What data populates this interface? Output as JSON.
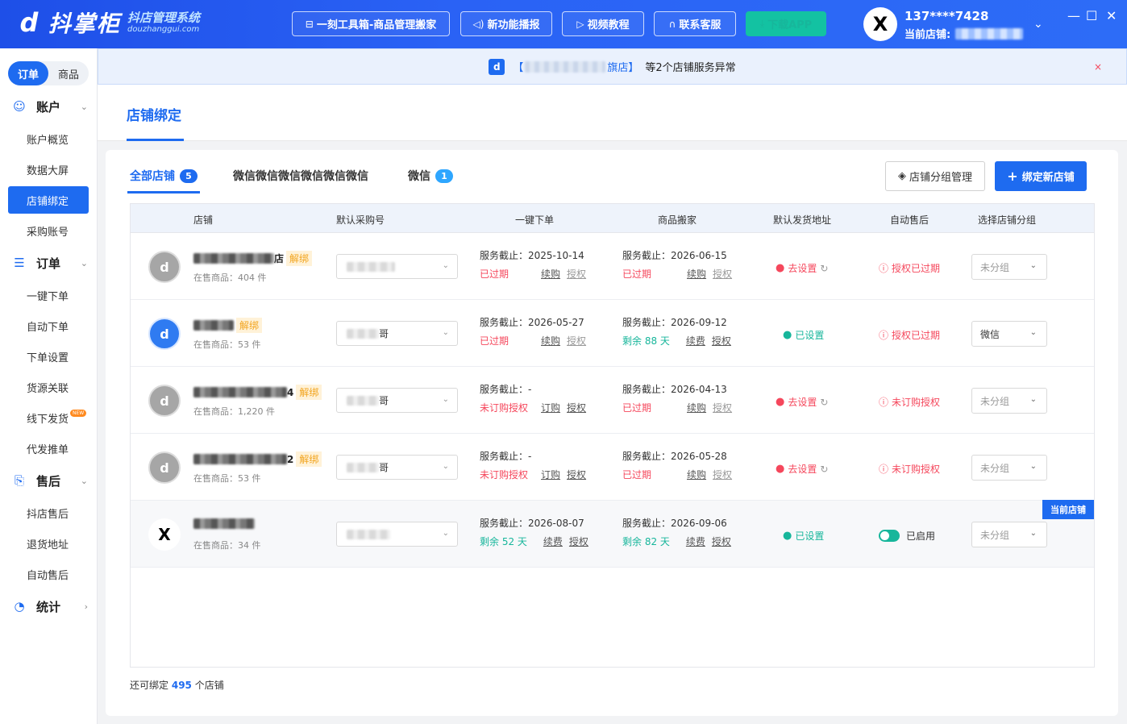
{
  "app": {
    "logo_mark": "d",
    "name": "抖掌柜",
    "subtitle": "抖店管理系统",
    "domain": "douzhanggui.com"
  },
  "toolbar": {
    "tools_label": "一刻工具箱-商品管理搬家",
    "news_label": "新功能播报",
    "video_label": "视频教程",
    "service_label": "联系客服",
    "download_label": "下载APP"
  },
  "user": {
    "avatar": "X",
    "phone": "137****7428",
    "store_label": "当前店铺:"
  },
  "window": {
    "minimize": "—",
    "maximize": "☐",
    "close": "✕"
  },
  "sidebar": {
    "seg": [
      "订单",
      "商品"
    ],
    "groups": {
      "account": {
        "label": "账户",
        "items": [
          "账户概览",
          "数据大屏",
          "店铺绑定",
          "采购账号"
        ]
      },
      "order": {
        "label": "订单",
        "items": [
          "一键下单",
          "自动下单",
          "下单设置",
          "货源关联",
          "线下发货",
          "代发推单"
        ]
      },
      "after": {
        "label": "售后",
        "items": [
          "抖店售后",
          "退货地址",
          "自动售后"
        ]
      },
      "stats": {
        "label": "统计"
      }
    },
    "new_tag": "NEW"
  },
  "notice": {
    "logo": "d",
    "prefix": "【",
    "store_suffix": "旗店】",
    "text": "等2个店铺服务异常",
    "close": "×"
  },
  "page": {
    "title": "店铺绑定"
  },
  "tabs": [
    {
      "label": "全部店铺",
      "count": "5"
    },
    {
      "label": "微信微信微信微信微信微信"
    },
    {
      "label": "微信",
      "count": "1"
    }
  ],
  "actions": {
    "group_manage": "店铺分组管理",
    "bind_new": "绑定新店铺"
  },
  "table": {
    "headers": [
      "店铺",
      "默认采购号",
      "一键下单",
      "商品搬家",
      "默认发货地址",
      "自动售后",
      "选择店铺分组"
    ],
    "rows": [
      {
        "avatar": "d",
        "name_suffix": "店",
        "unbind": "解绑",
        "goods": "在售商品：404 件",
        "buyer_suffix": "",
        "order_deadline": "服务截止：2025-10-14",
        "order_status": "已过期",
        "order_link1": "续购",
        "order_link2": "授权",
        "move_deadline": "服务截止：2026-06-15",
        "move_status": "已过期",
        "move_link1": "续购",
        "move_link2": "授权",
        "address": "去设置",
        "after": "授权已过期",
        "group": "未分组"
      },
      {
        "avatar": "d",
        "name_suffix": "",
        "unbind": "解绑",
        "goods": "在售商品：53 件",
        "buyer_suffix": "哥",
        "order_deadline": "服务截止：2026-05-27",
        "order_status": "已过期",
        "order_link1": "续购",
        "order_link2": "授权",
        "move_deadline": "服务截止：2026-09-12",
        "move_status": "剩余 88 天",
        "move_link1": "续费",
        "move_link2": "授权",
        "address": "已设置",
        "after": "授权已过期",
        "group": "微信"
      },
      {
        "avatar": "d",
        "name_suffix": "4",
        "unbind": "解绑",
        "goods": "在售商品：1,220 件",
        "buyer_suffix": "哥",
        "order_deadline": "服务截止：-",
        "order_status": "未订购授权",
        "order_link1": "订购",
        "order_link2": "授权",
        "move_deadline": "服务截止：2026-04-13",
        "move_status": "已过期",
        "move_link1": "续购",
        "move_link2": "授权",
        "address": "去设置",
        "after": "未订购授权",
        "group": "未分组"
      },
      {
        "avatar": "d",
        "name_suffix": "2",
        "unbind": "解绑",
        "goods": "在售商品：53 件",
        "buyer_suffix": "哥",
        "order_deadline": "服务截止：-",
        "order_status": "未订购授权",
        "order_link1": "订购",
        "order_link2": "授权",
        "move_deadline": "服务截止：2026-05-28",
        "move_status": "已过期",
        "move_link1": "续购",
        "move_link2": "授权",
        "address": "去设置",
        "after": "未订购授权",
        "group": "未分组"
      },
      {
        "avatar": "X",
        "name_suffix": "",
        "unbind": "",
        "goods": "在售商品：34 件",
        "buyer_suffix": "",
        "order_deadline": "服务截止：2026-08-07",
        "order_status": "剩余 52 天",
        "order_link1": "续费",
        "order_link2": "授权",
        "move_deadline": "服务截止：2026-09-06",
        "move_status": "剩余 82 天",
        "move_link1": "续费",
        "move_link2": "授权",
        "address": "已设置",
        "after": "已启用",
        "group": "未分组",
        "current_tag": "当前店铺"
      }
    ]
  },
  "footer": {
    "prefix": "还可绑定",
    "count": "495",
    "suffix": "个店铺"
  },
  "colors": {
    "primary": "#1e6bf0",
    "danger": "#f5475c",
    "success": "#17b69b",
    "warning": "#f2a41e"
  }
}
